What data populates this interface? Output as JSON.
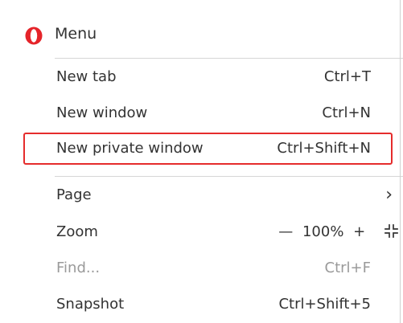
{
  "menu": {
    "title": "Menu",
    "logo_icon": "opera-logo-icon",
    "accent_color": "#e5242a",
    "highlight_color": "#e52c2c",
    "items": [
      {
        "label": "New tab",
        "shortcut": "Ctrl+T"
      },
      {
        "label": "New window",
        "shortcut": "Ctrl+N"
      },
      {
        "label": "New private window",
        "shortcut": "Ctrl+Shift+N",
        "highlighted": true
      },
      {
        "label": "Page",
        "submenu_icon": "chevron-right-icon",
        "chevron": "›"
      },
      {
        "label": "Zoom",
        "zoom_minus": "—",
        "zoom_level": "100%",
        "zoom_plus": "+",
        "fullscreen_icon": "fullscreen-icon"
      },
      {
        "label": "Find...",
        "shortcut": "Ctrl+F",
        "disabled": true
      },
      {
        "label": "Snapshot",
        "shortcut": "Ctrl+Shift+5"
      }
    ]
  }
}
